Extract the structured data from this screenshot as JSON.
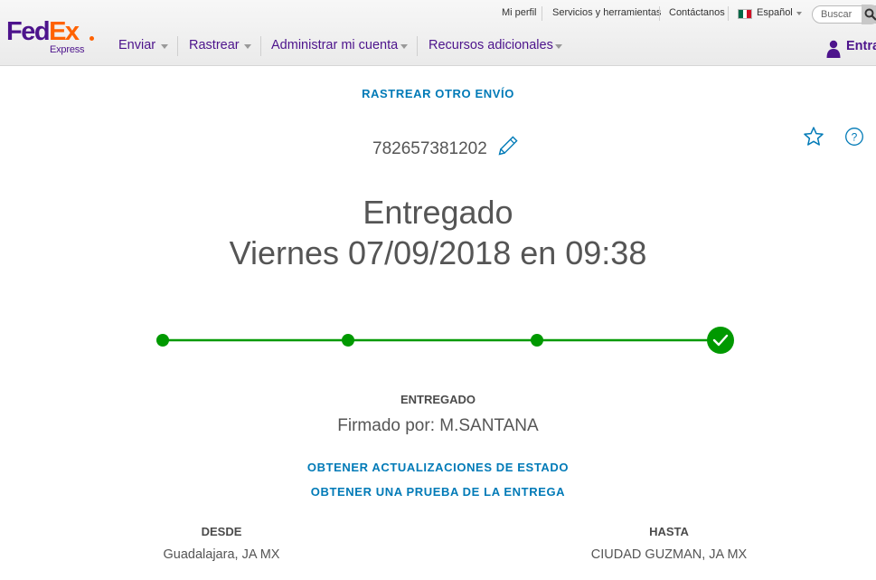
{
  "header": {
    "logo": {
      "fed": "Fed",
      "ex": "Ex",
      "sub": "Express"
    },
    "utility_links": [
      "Mi perfil",
      "Servicios y herramientas",
      "Contáctanos"
    ],
    "language": "Español",
    "search_placeholder": "Buscar",
    "nav": [
      "Enviar",
      "Rastrear",
      "Administrar mi cuenta",
      "Recursos adicionales"
    ],
    "login_label": "Entra"
  },
  "main": {
    "track_another_label": "RASTREAR OTRO ENVÍO",
    "tracking_number": "782657381202",
    "status_title": "Entregado",
    "status_datetime": "Viernes 07/09/2018 en 09:38",
    "progress": {
      "steps": 4,
      "completed": 4,
      "color": "#009900"
    },
    "status_label": "ENTREGADO",
    "signed_by": "Firmado por: M.SANTANA",
    "get_updates_label": "OBTENER ACTUALIZACIONES DE ESTADO",
    "proof_of_delivery_label": "OBTENER UNA PRUEBA DE LA ENTREGA",
    "from": {
      "label": "DESDE",
      "location": "Guadalajara, JA MX"
    },
    "to": {
      "label": "HASTA",
      "location": "CIUDAD GUZMAN, JA MX"
    }
  },
  "colors": {
    "brand_purple": "#4d148c",
    "brand_orange": "#ff6200",
    "link_blue": "#007ab7",
    "success_green": "#009900"
  }
}
